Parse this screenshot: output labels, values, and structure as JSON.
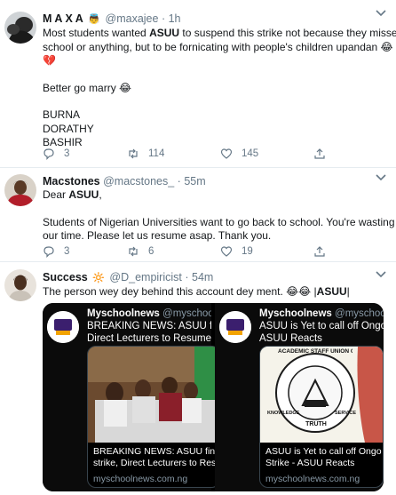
{
  "colors": {
    "accent": "#1b95e0",
    "muted": "#657786",
    "divider": "#e6ecf0"
  },
  "tweets": [
    {
      "name": "M A X A",
      "badge_icon": "angel-emoji",
      "handle": "@maxajee",
      "separator": "·",
      "time": "1h",
      "lines": {
        "l1_pre": "Most students wanted ",
        "l1_bold": "ASUU",
        "l1_post": " to suspend this strike not because they missed",
        "l2": "school or anything, but to be fornicating with people's children upandan 😂",
        "l3": "💔",
        "l4": "Better go marry 😂",
        "l5": "BURNA",
        "l6": "DORATHY",
        "l7": "BASHIR"
      },
      "replies": "3",
      "retweets": "114",
      "likes": "145"
    },
    {
      "name": "Macstones",
      "handle": "@macstones_",
      "separator": "·",
      "time": "55m",
      "lines": {
        "l1_pre": "Dear ",
        "l1_bold": "ASUU",
        "l1_post": ",",
        "l2": "Students of Nigerian Universities want to go back to school. You're wasting",
        "l3": "our time. Please let us resume asap. Thank you."
      },
      "replies": "3",
      "retweets": "6",
      "likes": "19"
    },
    {
      "name": "Success",
      "badge_icon": "sparkle-sun-emoji",
      "handle": "@D_empiricist",
      "separator": "·",
      "time": "54m",
      "text_pre": "The person wey dey behind this account dey ment. 😂😂 |",
      "text_bold": "ASUU",
      "text_post": "|",
      "media": [
        {
          "name": "Myschoolnews",
          "handle": "@myschoolnews",
          "headline": "BREAKING NEWS: ASUU finally c",
          "headline2": "Direct Lecturers to Resume Duties",
          "card_title": "BREAKING NEWS: ASUU finally",
          "card_title2": "strike, Direct Lecturers to Resum",
          "card_domain": "myschoolnews.com.ng"
        },
        {
          "name": "Myschoolnews",
          "handle": "@myschoolnews",
          "headline": "ASUU is Yet to call off Ongoin",
          "headline2": "ASUU Reacts",
          "card_title": "ASUU is Yet to call off Ongo",
          "card_title2": "Strike - ASUU Reacts",
          "card_domain": "myschoolnews.com.ng",
          "logo_text": "ACADEMIC STAFF UNION OF UNIVERSITIES",
          "logo_bottom": "TRUTH",
          "logo_left": "KNOWLEDGE",
          "logo_right": "SERVICE"
        }
      ]
    }
  ]
}
